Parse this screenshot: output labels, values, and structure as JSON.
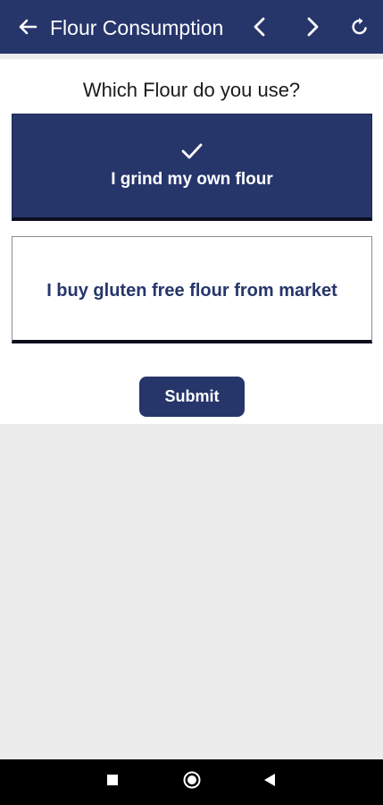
{
  "appbar": {
    "title": "Flour Consumption",
    "back_icon": "arrow-left-icon",
    "prev_icon": "chevron-left-icon",
    "next_icon": "chevron-right-icon",
    "refresh_icon": "refresh-icon"
  },
  "question": {
    "text": "Which Flour do you use?"
  },
  "options": [
    {
      "label": "I grind my own flour",
      "selected": true,
      "icon": "checkmark-icon"
    },
    {
      "label": "I buy gluten free flour from market",
      "selected": false
    }
  ],
  "submit": {
    "label": "Submit"
  },
  "system_nav": {
    "recents_icon": "square-icon",
    "home_icon": "circle-icon",
    "back_icon": "triangle-back-icon"
  },
  "colors": {
    "primary": "#26366b",
    "background": "#ececec",
    "card": "#ffffff",
    "nav_bar": "#000000"
  }
}
